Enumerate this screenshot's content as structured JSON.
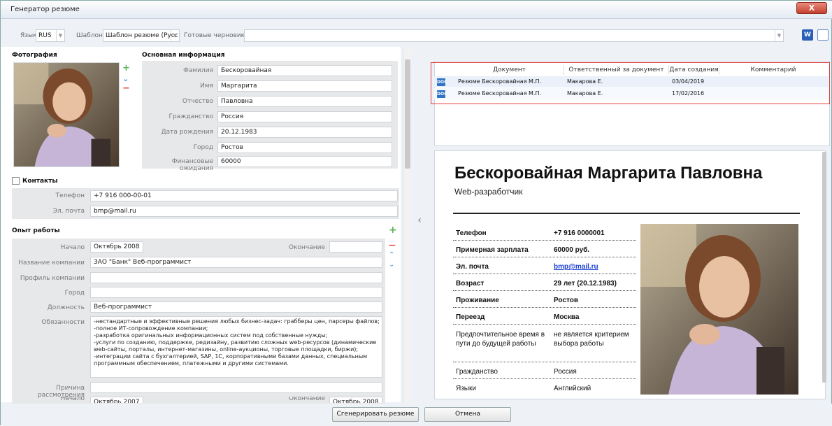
{
  "window": {
    "title": "Генератор резюме",
    "close_label": "X"
  },
  "toolbar": {
    "lang_label": "Язык",
    "lang_value": "RUS",
    "template_label": "Шаблон",
    "template_value": "Шаблон резюме (Русс",
    "drafts_label": "Готовые черновики",
    "drafts_value": ""
  },
  "photo_section": {
    "title": "Фотография"
  },
  "main_info": {
    "title": "Основная информация",
    "fields": [
      {
        "label": "Фамилия",
        "value": "Бескоровайная"
      },
      {
        "label": "Имя",
        "value": "Маргарита"
      },
      {
        "label": "Отчество",
        "value": "Павловна"
      },
      {
        "label": "Гражданство",
        "value": "Россия"
      },
      {
        "label": "Дата рождения",
        "value": "20.12.1983"
      },
      {
        "label": "Город",
        "value": "Ростов"
      },
      {
        "label": "Финансовые ожидания",
        "value": "60000"
      }
    ]
  },
  "contacts": {
    "title": "Контакты",
    "phone_label": "Телефон",
    "phone_value": "+7 916 000-00-01",
    "email_label": "Эл. почта",
    "email_value": "bmp@mail.ru"
  },
  "experience": {
    "title": "Опыт работы",
    "start_label": "Начало",
    "start_value": "Октябрь 2008",
    "end_label": "Окончание",
    "end_value": "",
    "company_label": "Название компании",
    "company_value": "ЗАО \"Банк\" Веб-программист",
    "profile_label": "Профиль компании",
    "profile_value": "",
    "city_label": "Город",
    "city_value": "",
    "position_label": "Должность",
    "position_value": "Веб-программист",
    "duties_label": "Обязанности",
    "duties_value": "-нестандартные и эффективные решения любых бизнес-задач: грабберы цен, парсеры файлов;\n-полное ИТ-сопровождение компании;\n-разработка оригинальных информационных систем под собственные нужды;\n-услуги по созданию, поддержке, редизайну, развитию сложных web-ресурсов (динамические web-сайты, порталы, интернет-магазины, online-аукционы, торговые площадки, биржи);\n-интеграции сайта с бухгалтерией, SAP, 1С, корпоративными базами данных, специальным программным обеспечением, платежными и другими системами.",
    "reason_label": "Причина рассмотрения",
    "reason_value": "",
    "next_start_label": "Начало",
    "next_start_value": "Октябрь 2007",
    "next_end_label": "Окончание",
    "next_end_value": "Октябрь 2008"
  },
  "documents": {
    "columns": [
      "Документ",
      "Ответственный за документ",
      "Дата создания",
      "Комментарий"
    ],
    "rows": [
      {
        "doc": "Резюме Бескоровайная М.П.",
        "owner": "Макарова Е.",
        "date": "03/04/2019",
        "comment": ""
      },
      {
        "doc": "Резюме Бескоровайная М.П.",
        "owner": "Макарова Е.",
        "date": "17/02/2016",
        "comment": ""
      }
    ]
  },
  "preview": {
    "name": "Бескоровайная Маргарита Павловна",
    "position": "Web-разработчик",
    "rows": [
      {
        "k": "Телефон",
        "v": "+7 916 0000001"
      },
      {
        "k": "Примерная зарплата",
        "v": "60000 руб."
      },
      {
        "k": "Эл. почта",
        "v": "bmp@mail.ru"
      },
      {
        "k": "Возраст",
        "v": "29 лет (20.12.1983)"
      },
      {
        "k": "Проживание",
        "v": "Ростов"
      },
      {
        "k": "Переезд",
        "v": "Москва"
      },
      {
        "k": "Предпочтительное время в пути до будущей работы",
        "v": "не является критерием выбора работы"
      },
      {
        "k": "Гражданство",
        "v": "Россия"
      },
      {
        "k": "Языки",
        "v": "Английский"
      }
    ]
  },
  "buttons": {
    "generate": "Сгенерировать резюме",
    "cancel": "Отмена"
  }
}
